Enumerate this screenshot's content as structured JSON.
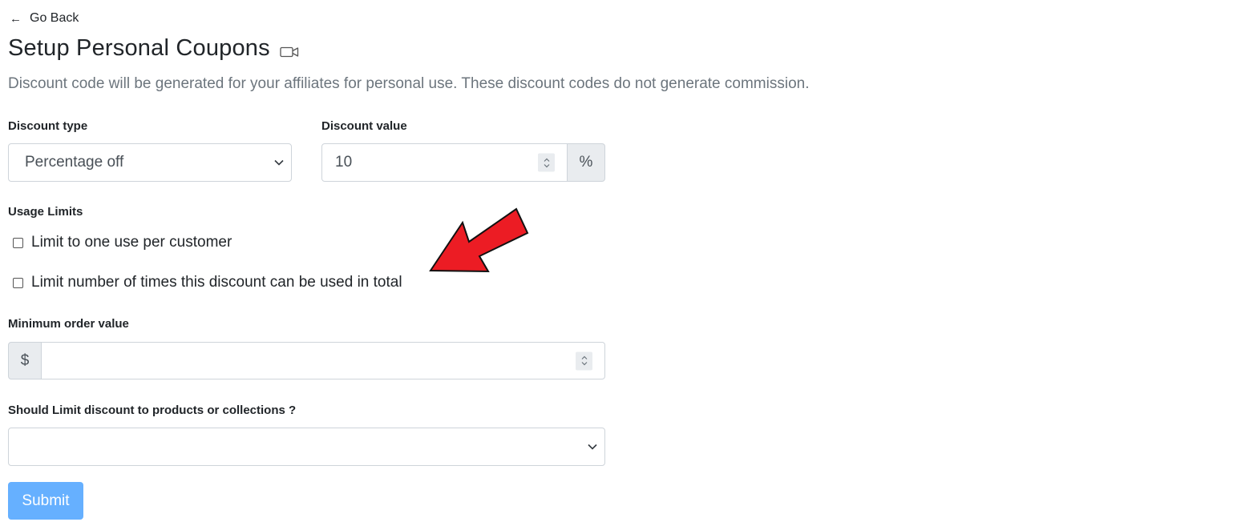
{
  "nav": {
    "back_label": "Go Back",
    "back_icon": "arrow-left-icon"
  },
  "header": {
    "title": "Setup Personal Coupons",
    "title_icon": "video-camera-icon",
    "subtitle": "Discount code will be generated for your affiliates for personal use. These discount codes do not generate commission."
  },
  "discount_type": {
    "label": "Discount type",
    "selected": "Percentage off"
  },
  "discount_value": {
    "label": "Discount value",
    "value": "10",
    "suffix": "%"
  },
  "usage_limits": {
    "label": "Usage Limits",
    "options": [
      {
        "label": "Limit to one use per customer",
        "checked": false
      },
      {
        "label": "Limit number of times this discount can be used in total",
        "checked": false
      }
    ]
  },
  "minimum_order": {
    "label": "Minimum order value",
    "prefix": "$",
    "value": ""
  },
  "limit_products": {
    "label": "Should Limit discount to products or collections ?",
    "selected": ""
  },
  "submit": {
    "label": "Submit"
  },
  "colors": {
    "submit_bg": "#66b0ff",
    "annotation_arrow": "#ec1c24",
    "muted_text": "#6c757d",
    "addon_bg": "#e9ecef"
  }
}
